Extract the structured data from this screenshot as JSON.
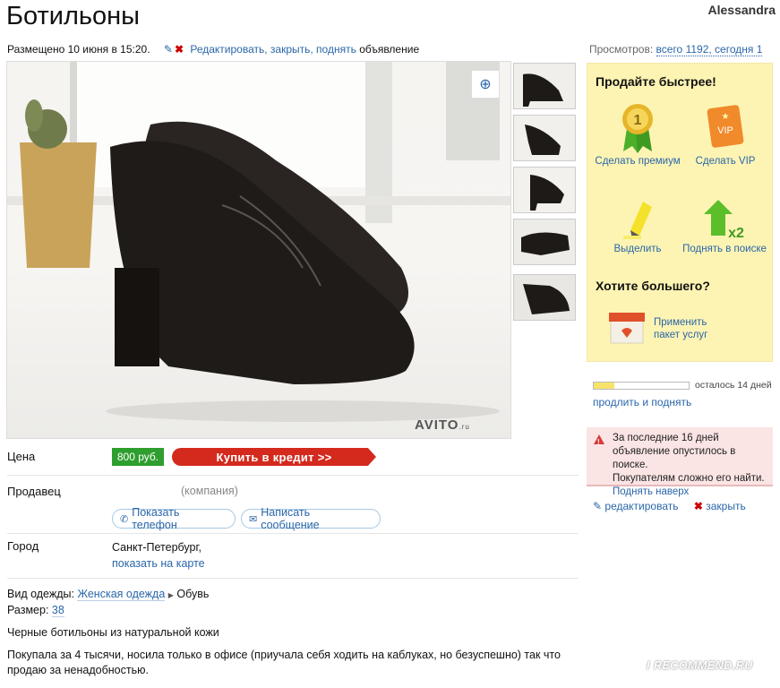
{
  "header": {
    "title": "Ботильоны",
    "user": "Alessandra"
  },
  "meta": {
    "posted": "Размещено 10 июня в 15:20.",
    "edit_link": "Редактировать, закрыть, поднять",
    "edit_suffix": "объявление",
    "views_label": "Просмотров:",
    "views_link": "всего 1192, сегодня 1"
  },
  "gallery": {
    "watermark_brand": "AVITO",
    "watermark_suffix": ".ru",
    "thumb_count": 5
  },
  "sidebar": {
    "sell_heading": "Продайте быстрее!",
    "services": [
      {
        "label": "Сделать премиум",
        "icon": "premium-medal-icon"
      },
      {
        "label": "Сделать VIP",
        "icon": "vip-tag-icon"
      },
      {
        "label": "Выделить",
        "icon": "highlighter-icon"
      },
      {
        "label": "Поднять в поиске",
        "icon": "raise-arrow-icon",
        "badge": "x2"
      }
    ],
    "more_heading": "Хотите большего?",
    "package_line1": "Применить",
    "package_line2": "пакет услуг",
    "progress_fraction": 0.22,
    "days_left": "осталось 14 дней",
    "extend_link": "продлить и поднять",
    "alert_line1": "За последние 16 дней",
    "alert_line2": "объявление опустилось в поиске.",
    "alert_line3": "Покупателям сложно его найти.",
    "alert_link": "Поднять наверх",
    "edit_action": "редактировать",
    "close_action": "закрыть"
  },
  "details": {
    "price_label": "Цена",
    "price_value": "800 руб.",
    "credit_button": "Купить в кредит >>",
    "seller_label": "Продавец",
    "seller_type": "(компания)",
    "show_phone": "Показать телефон",
    "write_message": "Написать сообщение",
    "city_label": "Город",
    "city_value": "Санкт-Петербург,",
    "map_link": "показать на карте",
    "clothing_label": "Вид одежды:",
    "clothing_link": "Женская одежда",
    "clothing_sub": "Обувь",
    "size_label": "Размер:",
    "size_value": "38",
    "desc_line1": "Черные ботильоны из натуральной кожи",
    "desc_para": "Покупала за 4 тысячи, носила только в офисе (приучала себя ходить на каблуках, но безуспешно) так что продаю за ненадобностью."
  },
  "watermark": "I RECOMMEND.RU"
}
